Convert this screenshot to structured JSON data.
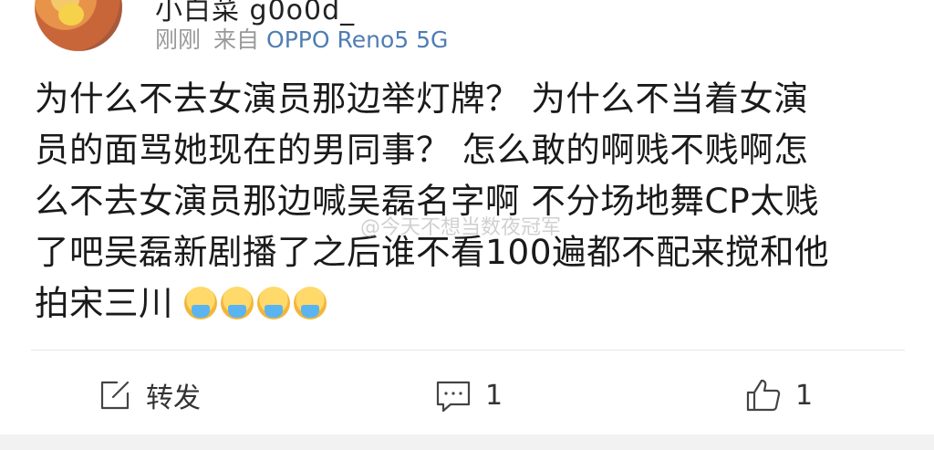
{
  "post": {
    "username": "小白菜 g0o0d_",
    "time": "刚刚",
    "from_label": "来自",
    "source": "OPPO Reno5 5G",
    "content_lines": [
      "为什么不去女演员那边举灯牌？ 为什么不当着女演",
      "员的面骂她现在的男同事？ 怎么敢的啊贱不贱啊怎",
      "么不去女演员那边喊吴磊名字啊 不分场地舞CP太贱",
      "了吧吴磊新剧播了之后谁不看100遍都不配来搅和他",
      "拍宋三川"
    ],
    "emoji_count": 4,
    "watermark": "@今天不想当数夜冠军"
  },
  "actions": {
    "repost_label": "转发",
    "comment_count": "1",
    "like_count": "1"
  },
  "icons": {
    "repost": "share-icon",
    "comment": "comment-icon",
    "like": "thumbs-up-icon"
  }
}
